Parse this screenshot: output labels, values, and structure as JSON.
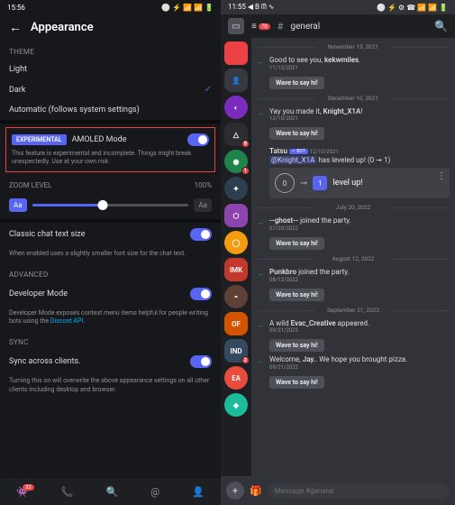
{
  "left": {
    "status_time": "15:56",
    "status_icons": "⚪ ⚡ 📶 📶 🔋",
    "header_title": "Appearance",
    "sections": {
      "theme": "THEME",
      "zoom": "ZOOM LEVEL",
      "advanced": "ADVANCED",
      "sync": "SYNC"
    },
    "theme_options": {
      "light": "Light",
      "dark": "Dark",
      "auto": "Automatic (follows system settings)"
    },
    "experimental": {
      "badge": "EXPERIMENTAL",
      "label": "AMOLED Mode",
      "desc": "This feature is experimental and incomplete. Things might break unexpectedly. Use at your own risk."
    },
    "zoom_value": "100%",
    "aa": "Aa",
    "classic": {
      "label": "Classic chat text size",
      "desc": "When enabled uses a slightly smaller font size for the chat text."
    },
    "dev": {
      "label": "Developer Mode",
      "desc_pre": "Developer Mode exposes context menu items helpful for people writing bots using the ",
      "link": "Discord API",
      "desc_post": "."
    },
    "sync": {
      "label": "Sync across clients.",
      "desc": "Turning this on will overwrite the above appearance settings on all other clients including desktop and browser."
    },
    "nav_badge": "32"
  },
  "right": {
    "status_time": "11:55",
    "status_left_icons": "◀ B ᗰ ∿",
    "status_right_icons": "⚪ ⚡ ⚙ ☎ 📶 📶 🔋",
    "filter_badge": "70",
    "hash": "#",
    "channel": "general",
    "servers": [
      {
        "bg": "#ed4245",
        "txt": "",
        "type": "folder"
      },
      {
        "bg": "#36393f",
        "txt": "👤",
        "type": "sq"
      },
      {
        "bg": "#7b2cbf",
        "txt": "◐",
        "type": "round"
      },
      {
        "bg": "#2b2d31",
        "txt": "△",
        "type": "sq",
        "badge": "9"
      },
      {
        "bg": "#1e8449",
        "txt": "◉",
        "type": "round",
        "badge": "1"
      },
      {
        "bg": "#2c3e50",
        "txt": "✦",
        "type": "round"
      },
      {
        "bg": "#8e44ad",
        "txt": "⬡",
        "type": "sq"
      },
      {
        "bg": "#f39c12",
        "txt": "◯",
        "type": "round"
      },
      {
        "bg": "#c0392b",
        "txt": "IMK",
        "type": "sq"
      },
      {
        "bg": "#5d4037",
        "txt": "◓",
        "type": "round"
      },
      {
        "bg": "#d35400",
        "txt": "OF",
        "type": "sq"
      },
      {
        "bg": "#34495e",
        "txt": "IND",
        "type": "sq",
        "badge": "2"
      },
      {
        "bg": "#e74c3c",
        "txt": "EA",
        "type": "round"
      },
      {
        "bg": "#1abc9c",
        "txt": "◈",
        "type": "round"
      }
    ],
    "dates": {
      "d1": "November 13, 2021",
      "d2": "December 10, 2021",
      "d3": "July 20, 2022",
      "d4": "August 12, 2022",
      "d5": "September 21, 2022"
    },
    "msgs": {
      "m1_text_pre": "Good to see you, ",
      "m1_user": "kekwmiles",
      "m1_time": "11/13/2021",
      "m2_text_pre": "Yay you made it, ",
      "m2_user": "Knight_X1A",
      "m2_time": "12/10/2021",
      "bot_name": "Tatsu",
      "bot_tag": "✓ BOT",
      "bot_time": "12/10/2021",
      "bot_mention": "@Knight_X1A",
      "bot_text": " has leveled up! (0 ➞ 1)",
      "lvl_from": "0",
      "lvl_to": "1",
      "lvl_label": "level up!",
      "m3_user": "--ghost--",
      "m3_text": " joined the party.",
      "m3_time": "07/20/2022",
      "m4_user": "Punkbro",
      "m4_text": " joined the party.",
      "m4_time": "08/12/2022",
      "m5_text_pre": "A wild ",
      "m5_user": "Evac_Creative",
      "m5_text_post": " appeared.",
      "m5_time": "09/21/2022",
      "m6_text_pre": "Welcome, ",
      "m6_user": "Jay.",
      "m6_text_post": ". We hope you brought pizza.",
      "m6_time": "09/21/2022"
    },
    "wave": "Wave to say hi!",
    "input_placeholder": "Message #general"
  }
}
